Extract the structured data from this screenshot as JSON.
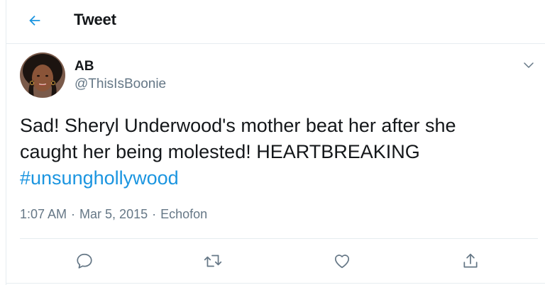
{
  "header": {
    "title": "Tweet",
    "back_icon": "arrow-left-icon"
  },
  "tweet": {
    "author": {
      "name": "AB",
      "handle": "@ThisIsBoonie"
    },
    "text_line1": "Sad! Sheryl Underwood's mother beat her after she",
    "text_line2": "caught her being molested! HEARTBREAKING",
    "hashtag": "#unsunghollywood",
    "time": "1:07 AM",
    "date": "Mar 5, 2015",
    "source": "Echofon",
    "separator": "·"
  },
  "actions": {
    "reply_icon": "reply-icon",
    "retweet_icon": "retweet-icon",
    "like_icon": "heart-icon",
    "share_icon": "share-icon"
  },
  "colors": {
    "accent": "#1b95e0",
    "text_primary": "#14171a",
    "text_secondary": "#657786",
    "divider": "#e6ecf0"
  }
}
